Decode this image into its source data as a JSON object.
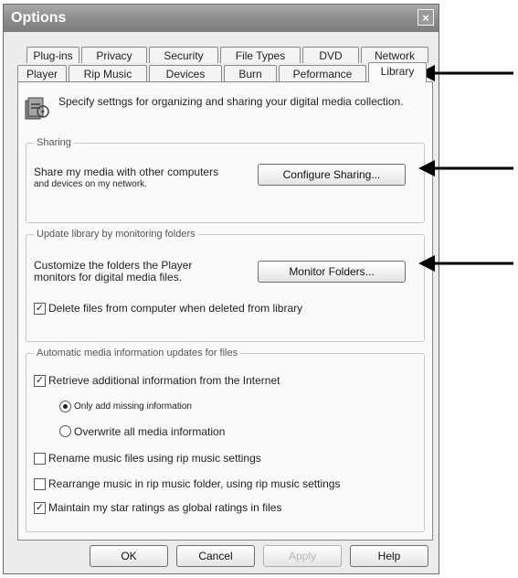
{
  "window": {
    "title": "Options",
    "close_glyph": "×"
  },
  "tabs": {
    "row1": [
      "Plug-ins",
      "Privacy",
      "Security",
      "File Types",
      "DVD",
      "Network"
    ],
    "row2": [
      "Player",
      "Rip Music",
      "Devices",
      "Burn",
      "Peformance",
      "Library"
    ],
    "active": "Library"
  },
  "description": {
    "icon": "media-library-icon",
    "text": "Specify settngs for organizing and sharing your digital media collection."
  },
  "sharing": {
    "title": "Sharing",
    "line1": "Share my media with other computers",
    "line2": "and devices on my network.",
    "button": "Configure Sharing..."
  },
  "monitor": {
    "title": "Update library by monitoring folders",
    "line1": "Customize the folders the Player",
    "line2": "monitors for digital media files.",
    "button": "Monitor Folders...",
    "delete_label": "Delete files from computer when deleted from library",
    "delete_checked": true
  },
  "auto_updates": {
    "title": "Automatic media information updates for files",
    "retrieve_label": "Retrieve additional information from the Internet",
    "retrieve_checked": true,
    "radio_missing": "Only add missing information",
    "radio_overwrite": "Overwrite all media information",
    "selected_radio": "radio_missing",
    "rename_label": "Rename music files using rip music settings",
    "rename_checked": false,
    "rearrange_label": "Rearrange music in rip music folder, using rip music settings",
    "rearrange_checked": false,
    "star_label": "Maintain my star ratings as global ratings in files",
    "star_checked": true
  },
  "footer": {
    "ok": "OK",
    "cancel": "Cancel",
    "apply": "Apply",
    "help": "Help"
  },
  "colors": {
    "arrow": "#000000",
    "titlebar": "#8b8b8b"
  }
}
